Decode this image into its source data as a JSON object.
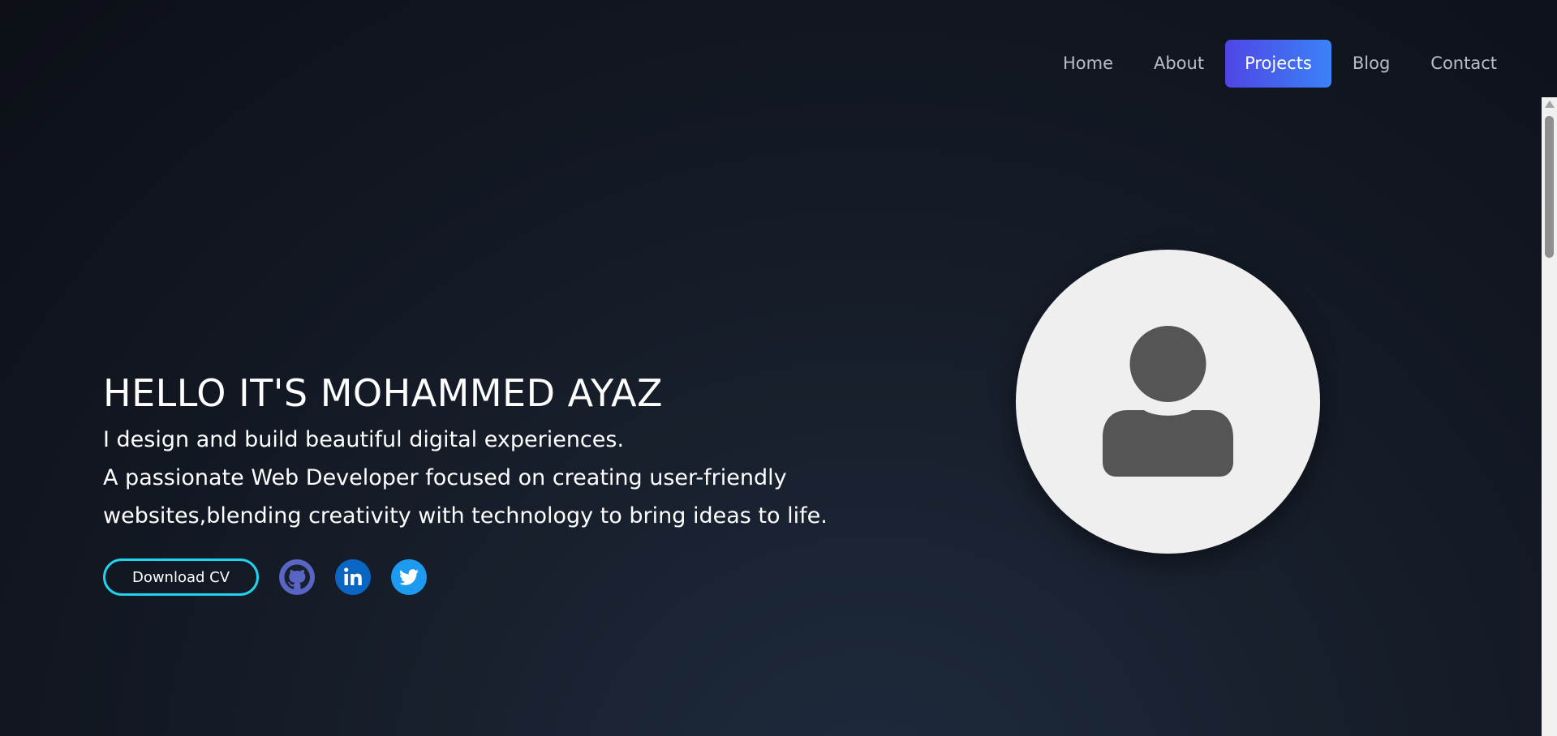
{
  "nav": {
    "items": [
      {
        "label": "Home",
        "active": false
      },
      {
        "label": "About",
        "active": false
      },
      {
        "label": "Projects",
        "active": true
      },
      {
        "label": "Blog",
        "active": false
      },
      {
        "label": "Contact",
        "active": false
      }
    ]
  },
  "hero": {
    "title": "HELLO IT'S MOHAMMED AYAZ",
    "subtitle_line1": "I design and build beautiful digital experiences.",
    "subtitle_line2": "A passionate Web Developer focused on creating user-friendly",
    "subtitle_line3": "websites,blending creativity with technology to bring ideas to life.",
    "cv_button_label": "Download CV"
  },
  "social": [
    {
      "icon": "github-icon",
      "color": "#5865c2"
    },
    {
      "icon": "linkedin-icon",
      "color": "#0a66c2"
    },
    {
      "icon": "twitter-icon",
      "color": "#1d9bf0"
    }
  ],
  "avatar": {
    "icon": "user-placeholder-icon",
    "background": "#efefef",
    "foreground": "#555555"
  },
  "colors": {
    "accent_gradient_start": "#4f46e5",
    "accent_gradient_end": "#3b82f6",
    "cv_border": "#22d3ee",
    "nav_text": "#b8bec9"
  }
}
